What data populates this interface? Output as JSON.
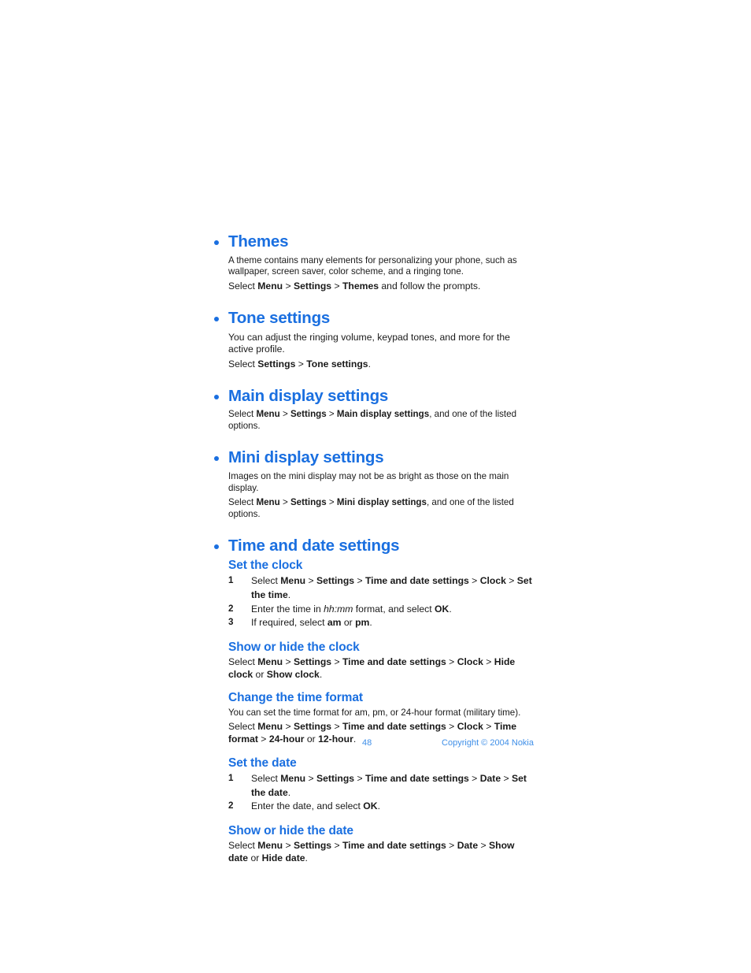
{
  "document": {
    "page_number": "48",
    "copyright": "Copyright © 2004 Nokia",
    "heading_color": "#1a6fe0",
    "footer_color": "#3f8fe8",
    "body_color": "#1a1a1a"
  },
  "sections": {
    "themes": {
      "title": "Themes",
      "paragraph": "A theme contains many elements for personalizing your phone, such as wallpaper, screen saver, color scheme, and a ringing tone.",
      "select_prefix": "Select ",
      "menu": "Menu",
      "sep1": " > ",
      "settings": "Settings",
      "sep2": " > ",
      "themes": "Themes",
      "suffix": " and follow the prompts."
    },
    "tone_settings": {
      "title": "Tone settings",
      "paragraph": "You can adjust the ringing volume, keypad tones, and more for the active profile.",
      "select_prefix": "Select ",
      "settings": "Settings",
      "sep1": " > ",
      "tone_settings": "Tone settings",
      "suffix": "."
    },
    "main_display": {
      "title": "Main display settings",
      "select_prefix": "Select ",
      "menu": "Menu",
      "sep1": " > ",
      "settings": "Settings",
      "sep2": " > ",
      "main_display_settings": "Main display settings",
      "suffix": ", and one of the listed options."
    },
    "mini_display": {
      "title": "Mini display settings",
      "paragraph": "Images on the mini display may not be as bright as those on the main display.",
      "select_prefix": "Select ",
      "menu": "Menu",
      "sep1": " > ",
      "settings": "Settings",
      "sep2": " > ",
      "mini_display_settings": "Mini display settings",
      "suffix": ", and one of the listed options."
    },
    "time_and_date": {
      "title": "Time and date settings",
      "set_the_clock": {
        "title": "Set the clock",
        "steps": [
          {
            "number": "1",
            "prefix": "Select ",
            "b1": "Menu",
            "s1": " > ",
            "b2": "Settings",
            "s2": " > ",
            "b3": "Time and date settings",
            "s3": " > ",
            "b4": "Clock",
            "s4": " > ",
            "b5": "Set the time",
            "suffix": "."
          },
          {
            "number": "2",
            "prefix": "Enter the time in ",
            "italic": "hh:mm",
            "middle": " format, and select ",
            "b1": "OK",
            "suffix": "."
          },
          {
            "number": "3",
            "prefix": "If required, select ",
            "b1": "am",
            "middle": " or ",
            "b2": "pm",
            "suffix": "."
          }
        ]
      },
      "show_or_hide_clock": {
        "title": "Show or hide the clock",
        "select_prefix": "Select ",
        "b1": "Menu",
        "s1": " > ",
        "b2": "Settings",
        "s2": " > ",
        "b3": "Time and date settings",
        "s3": " > ",
        "b4": "Clock",
        "s4": " > ",
        "b5": "Hide clock",
        "or": " or ",
        "b6": "Show clock",
        "suffix": "."
      },
      "change_time_format": {
        "title": "Change the time format",
        "paragraph": "You can set the time format for am, pm, or 24-hour format (military time).",
        "select_prefix": "Select ",
        "b1": "Menu",
        "s1": " > ",
        "b2": "Settings",
        "s2": " > ",
        "b3": "Time and date settings",
        "s3": " > ",
        "b4": "Clock",
        "s4": " > ",
        "b5": "Time format",
        "s5": " > ",
        "b6": "24-hour",
        "or": " or ",
        "b7": "12-hour",
        "suffix": "."
      },
      "set_the_date": {
        "title": "Set the date",
        "steps": [
          {
            "number": "1",
            "prefix": "Select ",
            "b1": "Menu",
            "s1": " > ",
            "b2": "Settings",
            "s2": " > ",
            "b3": "Time and date settings",
            "s3": " > ",
            "b4": "Date",
            "s4": " > ",
            "b5": "Set the date",
            "suffix": "."
          },
          {
            "number": "2",
            "prefix": "Enter the date, and select ",
            "b1": "OK",
            "suffix": "."
          }
        ]
      },
      "show_or_hide_date": {
        "title": "Show or hide the date",
        "select_prefix": "Select ",
        "b1": "Menu",
        "s1": " > ",
        "b2": "Settings",
        "s2": " > ",
        "b3": "Time and date settings",
        "s3": " > ",
        "b4": "Date",
        "s4": " > ",
        "b5": "Show date",
        "or": " or ",
        "b6": "Hide date",
        "suffix": "."
      }
    }
  }
}
